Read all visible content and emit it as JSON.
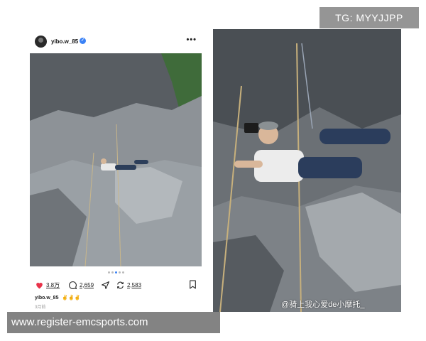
{
  "post": {
    "username": "yibo.w_85",
    "more_icon": "more-horizontal-icon",
    "verified_icon": "verified-badge-icon",
    "carousel": {
      "count": 5,
      "active_index": 2
    },
    "actions": {
      "likes": "3.8万",
      "comments": "2,659",
      "reposts": "2,583"
    },
    "caption_name": "yibo.w_85",
    "caption_emoji": "✌✌✌",
    "timestamp": "3月前"
  },
  "zoom_photo": {
    "watermark": "@骑上我心爱de小摩托_"
  },
  "overlays": {
    "tg_label": "TG: MYYJJPP",
    "url_label": "www.register-emcsports.com"
  },
  "colors": {
    "like_red": "#e8334a",
    "verified_blue": "#3b82f6",
    "rock_gray": "#6e7378",
    "banner_gray": "#8c8c8c"
  }
}
